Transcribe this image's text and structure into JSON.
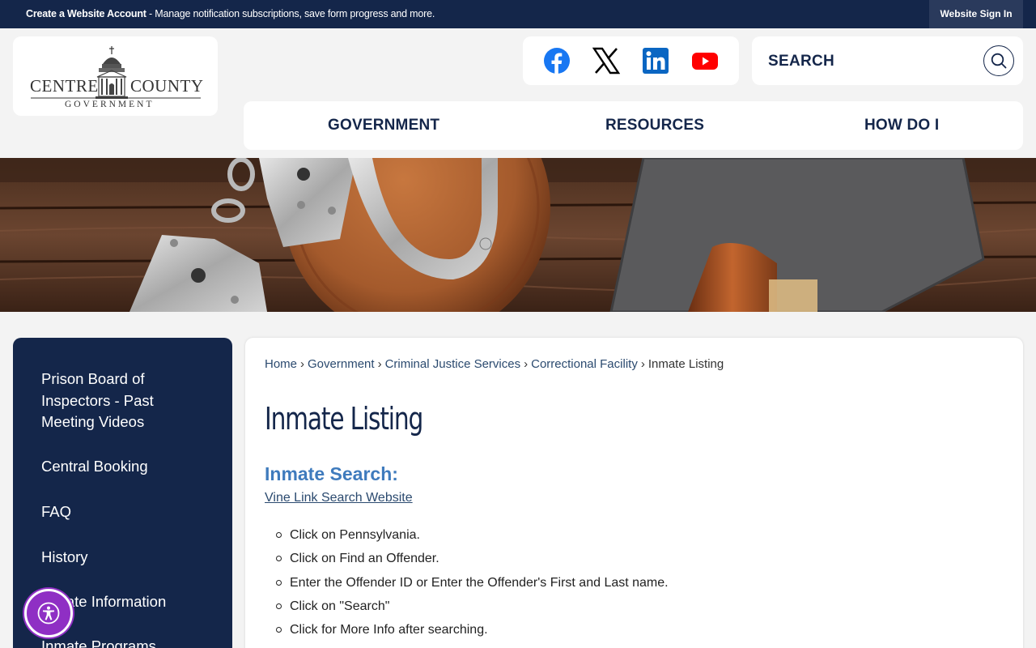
{
  "topbar": {
    "account_link": "Create a Website Account",
    "message": " - Manage notification subscriptions, save form progress and more.",
    "signin": "Website Sign In"
  },
  "logo": {
    "name_left": "CENTRE",
    "name_right": "COUNTY",
    "subtitle": "GOVERNMENT"
  },
  "social": {
    "icons": [
      "facebook-icon",
      "x-icon",
      "linkedin-icon",
      "youtube-icon"
    ],
    "colors": {
      "facebook": "#1877f2",
      "x": "#000000",
      "linkedin": "#0a66c2",
      "youtube": "#ff0000"
    }
  },
  "search": {
    "label": "SEARCH"
  },
  "nav": {
    "items": [
      "GOVERNMENT",
      "RESOURCES",
      "HOW DO I"
    ]
  },
  "sidebar": {
    "items": [
      "Prison Board of Inspectors - Past Meeting Videos",
      "Central Booking",
      "FAQ",
      "History",
      "Inmate Information",
      "Inmate Programs"
    ]
  },
  "breadcrumb": [
    "Home",
    "Government",
    "Criminal Justice Services",
    "Correctional Facility",
    "Inmate Listing"
  ],
  "main": {
    "title": "Inmate Listing",
    "subheading": "Inmate Search:",
    "link": "Vine Link Search Website",
    "steps": [
      "Click on Pennsylvania.",
      "Click on Find an Offender.",
      "Enter the Offender ID or Enter the Offender's First and Last name.",
      "Click on \"Search\"",
      "Click for More Info after searching."
    ]
  },
  "colors": {
    "navy": "#14264a",
    "accent_blue": "#3f7bbd",
    "a11y_purple": "#8f2fc4",
    "page_bg": "#f3f3f3"
  }
}
